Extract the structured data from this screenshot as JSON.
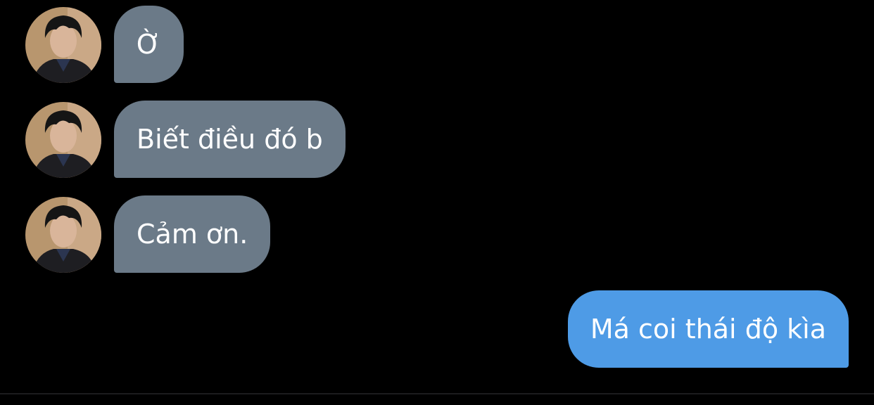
{
  "conversation": {
    "messages": [
      {
        "direction": "incoming",
        "text": "Ờ"
      },
      {
        "direction": "incoming",
        "text": "Biết điều đó b"
      },
      {
        "direction": "incoming",
        "text": "Cảm ơn."
      },
      {
        "direction": "outgoing",
        "text": "Má coi thái độ kìa"
      }
    ]
  },
  "colors": {
    "background": "#000000",
    "incoming_bubble": "#6b7a88",
    "outgoing_bubble": "#4e9be6",
    "text": "#ffffff"
  },
  "icons": {
    "avatar": "contact-avatar-photo"
  }
}
